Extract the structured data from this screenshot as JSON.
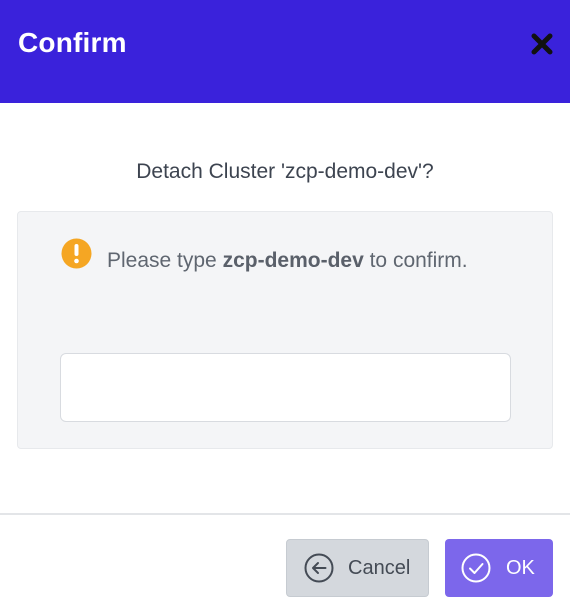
{
  "dialog": {
    "title": "Confirm",
    "question": "Detach Cluster 'zcp-demo-dev'?",
    "message_prefix": "Please type ",
    "cluster_name": "zcp-demo-dev",
    "message_suffix": " to confirm.",
    "input_value": "",
    "input_placeholder": "",
    "cancel_label": "Cancel",
    "ok_label": "OK"
  },
  "icons": {
    "close": "close-icon",
    "warning": "warning-icon",
    "cancel": "arrow-left-circle-icon",
    "ok": "check-circle-icon"
  },
  "colors": {
    "header": "#3a22db",
    "warning": "#f5a623",
    "ok_button": "#7c67eb",
    "cancel_button": "#d4d8dd"
  }
}
